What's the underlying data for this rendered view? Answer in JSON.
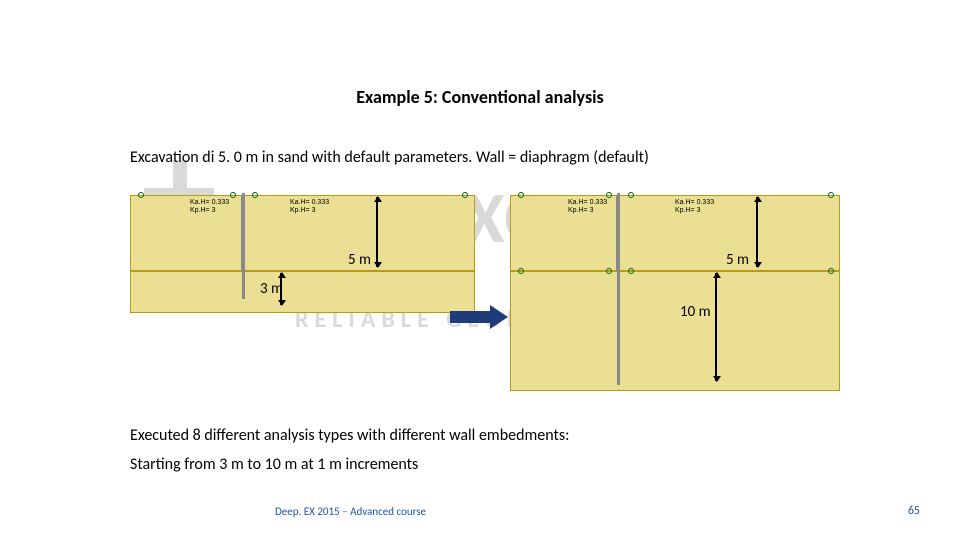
{
  "title": "Example 5: Conventional analysis",
  "intro": "Excavation di 5. 0 m in sand with default parameters. Wall = diaphragm (default)",
  "left_diagram": {
    "excavation_depth_label": "5 m",
    "embedment_label": "3 m",
    "param1_line1": "Ka.H= 0.333",
    "param1_line2": "Kp.H= 3",
    "param2_line1": "Ka.H= 0.333",
    "param2_line2": "Kp.H= 3"
  },
  "right_diagram": {
    "excavation_depth_label": "5 m",
    "embedment_label": "10 m",
    "param1_line1": "Ka.H= 0.333",
    "param1_line2": "Kp.H= 3",
    "param2_line1": "Ka.H= 0.333",
    "param2_line2": "Kp.H= 3"
  },
  "conclusion1": "Executed 8 different analysis types with different wall embedments:",
  "conclusion2": "Starting from 3 m to 10 m at 1 m increments",
  "footer": {
    "course": "Deep. EX 2015 – Advanced course",
    "page": "65"
  },
  "watermark": {
    "brand": "DEEP EXCAVATION",
    "tagline": "RELIABLE GEOEXPERTISE"
  }
}
